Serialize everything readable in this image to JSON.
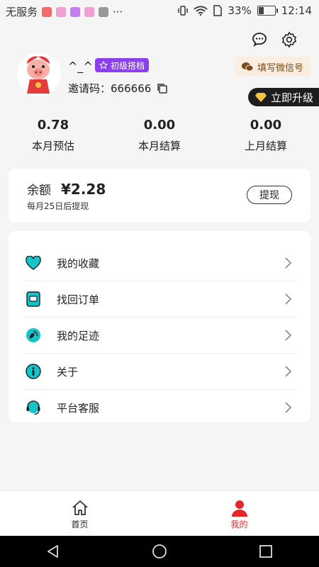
{
  "status_bar": {
    "carrier": "无服务",
    "battery": "33%",
    "time": "12:14",
    "notification_colors": [
      "#f26b6b",
      "#f0a0d0",
      "#c27ff0",
      "#f0a0d0",
      "#999999"
    ],
    "battery_level": 0.33
  },
  "header": {
    "wechat_button": "填写微信号",
    "upgrade_button": "立即升级",
    "message_icon": "chat-bubble-icon",
    "settings_icon": "gear-icon"
  },
  "profile": {
    "nickname": "^_^",
    "level_badge": "初级搭档",
    "invite_label": "邀请码：",
    "invite_code": "666666"
  },
  "stats": [
    {
      "value": "0.78",
      "label": "本月预估"
    },
    {
      "value": "0.00",
      "label": "本月结算"
    },
    {
      "value": "0.00",
      "label": "上月结算"
    }
  ],
  "balance": {
    "label": "余额",
    "amount": "¥2.28",
    "note": "每月25日后提现",
    "withdraw_button": "提现"
  },
  "menu": [
    {
      "label": "我的收藏",
      "icon": "heart-icon"
    },
    {
      "label": "找回订单",
      "icon": "order-icon"
    },
    {
      "label": "我的足迹",
      "icon": "footprint-icon"
    },
    {
      "label": "关于",
      "icon": "info-icon"
    },
    {
      "label": "平台客服",
      "icon": "headset-icon"
    }
  ],
  "tabbar": [
    {
      "label": "首页",
      "icon": "home-icon",
      "active": false
    },
    {
      "label": "我的",
      "icon": "user-icon",
      "active": true
    }
  ],
  "colors": {
    "accent_red": "#e5262a",
    "teal": "#16c4c4",
    "badge_purple": "#8a3ff0",
    "wechat_bg": "#fbeee0"
  }
}
